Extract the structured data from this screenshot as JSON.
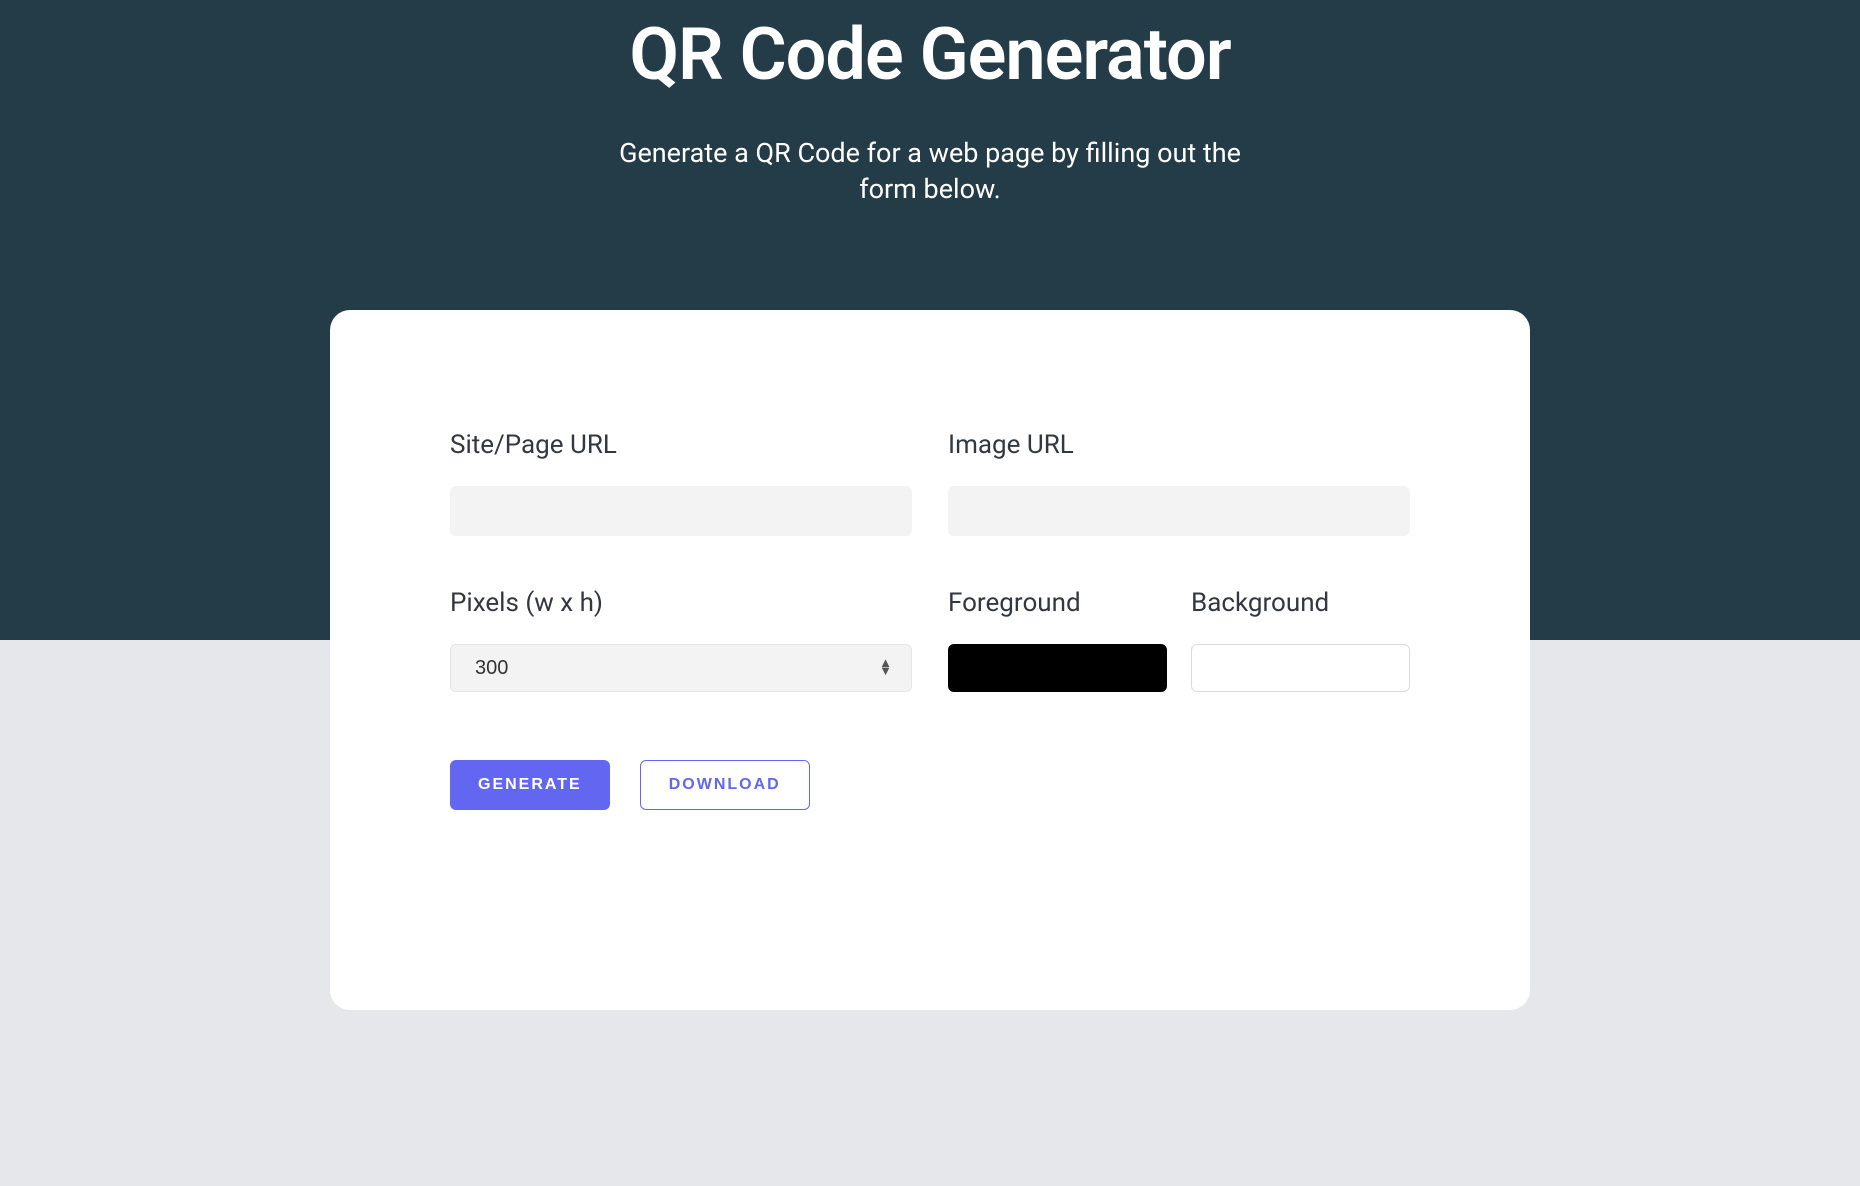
{
  "header": {
    "title": "QR Code Generator",
    "subtitle": "Generate a QR Code for a web page by filling out the form below."
  },
  "form": {
    "site_url": {
      "label": "Site/Page URL",
      "value": "",
      "placeholder": ""
    },
    "image_url": {
      "label": "Image URL",
      "value": "",
      "placeholder": ""
    },
    "pixels": {
      "label": "Pixels (w x h)",
      "value": "300"
    },
    "foreground": {
      "label": "Foreground",
      "value": "#000000"
    },
    "background": {
      "label": "Background",
      "value": "#ffffff"
    }
  },
  "buttons": {
    "generate": "GENERATE",
    "download": "DOWNLOAD"
  }
}
